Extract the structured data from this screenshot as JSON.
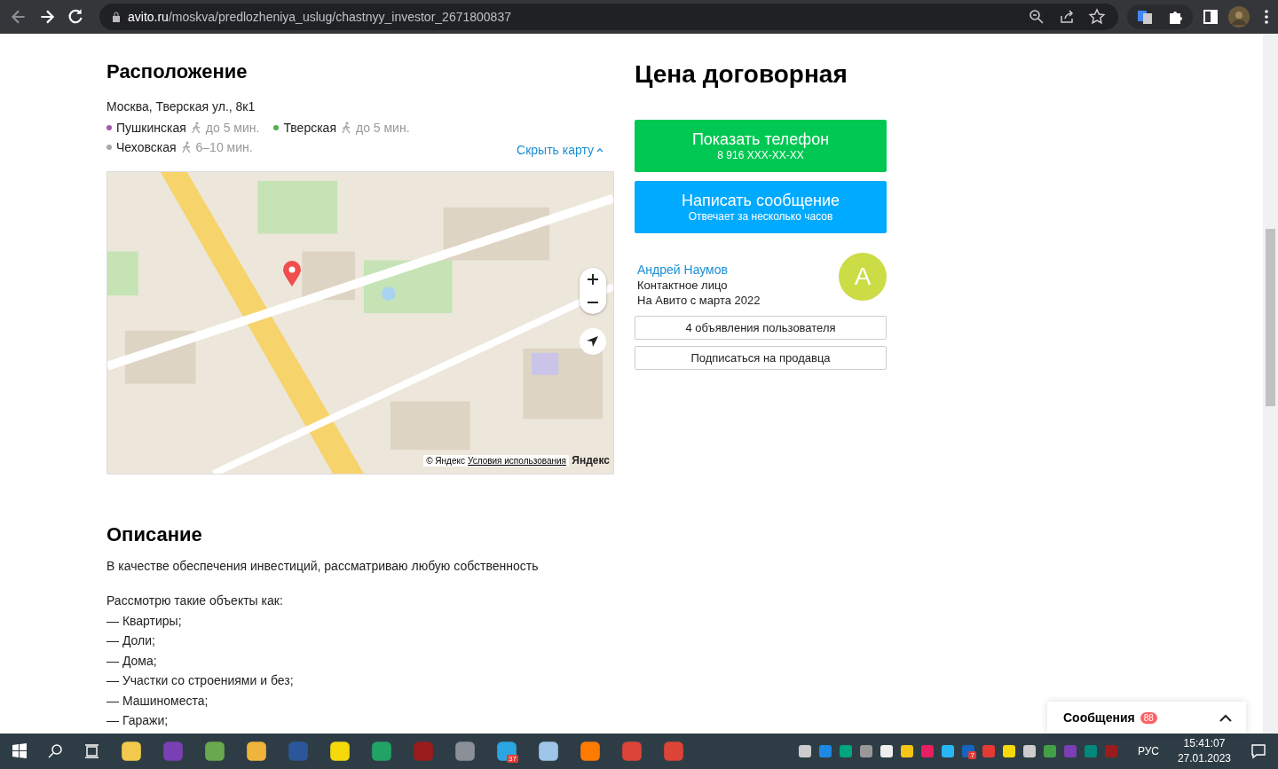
{
  "browser": {
    "url_host": "avito.ru",
    "url_path": "/moskva/predlozheniya_uslug/chastnyy_investor_2671800837"
  },
  "location": {
    "title": "Расположение",
    "address": "Москва, Тверская ул., 8к1",
    "metro": [
      {
        "name": "Пушкинская",
        "time": "до 5 мин.",
        "color": "#a05aa5"
      },
      {
        "name": "Тверская",
        "time": "до 5 мин.",
        "color": "#4fb04f"
      },
      {
        "name": "Чеховская",
        "time": "6–10 мин.",
        "color": "#a8a8a8"
      }
    ],
    "hide_map": "Скрыть карту",
    "map": {
      "kind": "picture",
      "copyright": "© Яндекс",
      "terms": "Условия использования",
      "brand": "Яндекс"
    }
  },
  "price": "Цена договорная",
  "phone_button": {
    "label": "Показать телефон",
    "sub": "8 916 XXX-XX-XX"
  },
  "message_button": {
    "label": "Написать сообщение",
    "sub": "Отвечает за несколько часов"
  },
  "seller": {
    "name": "Андрей Наумов",
    "role": "Контактное лицо",
    "since": "На Авито с марта 2022",
    "avatar": "А"
  },
  "seller_buttons": [
    "4 объявления пользователя",
    "Подписаться на продавца"
  ],
  "description": {
    "title": "Описание",
    "paragraph": "В качестве обеспечения инвестиций, рассматриваю любую собственность",
    "lines": [
      "Рассмотрю такие объекты как:",
      "— Квартиры;",
      "— Доли;",
      "— Дома;",
      "— Участки со строениями и без;",
      "— Машиноместа;",
      "— Гаражи;"
    ]
  },
  "messages": {
    "label": "Сообщения",
    "count": "88"
  },
  "taskbar": {
    "telegram_badge": "37",
    "tray_badge": "7",
    "language": "РУС",
    "time": "15:41:07",
    "date": "27.01.2023"
  }
}
